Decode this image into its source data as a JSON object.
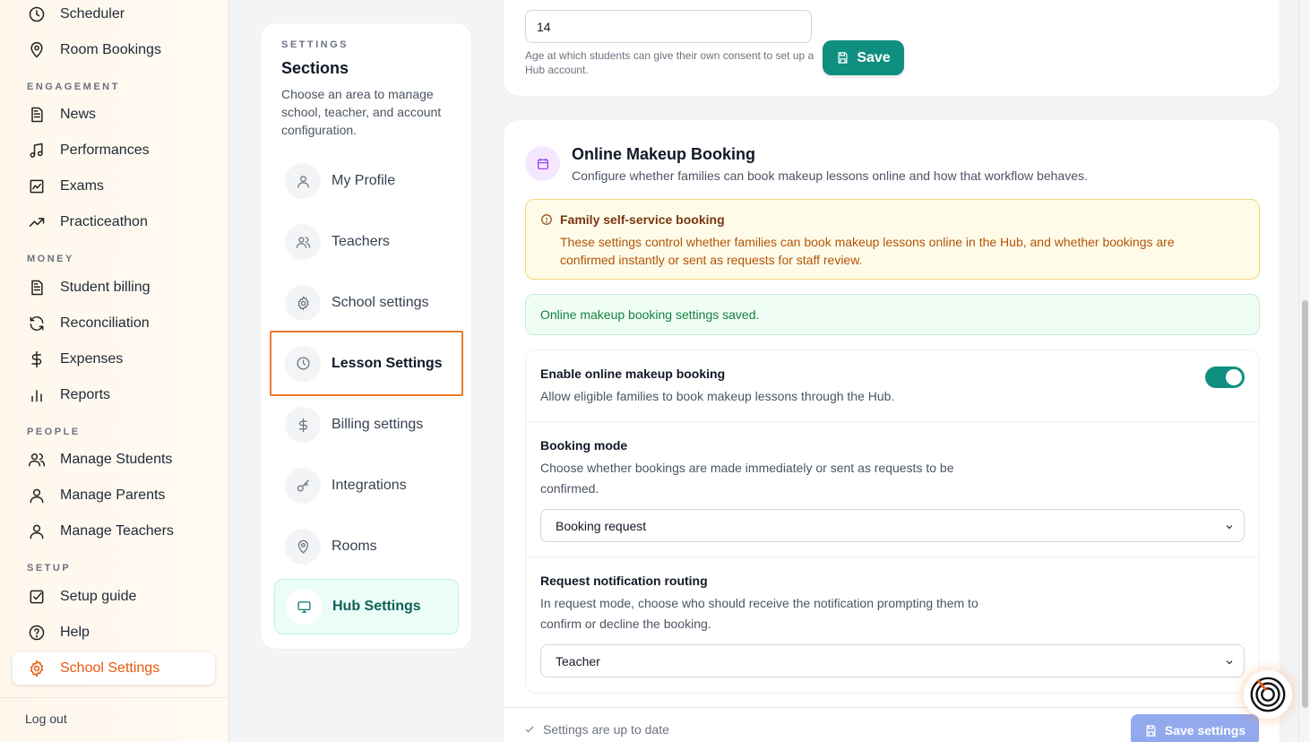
{
  "sidebar": {
    "items_top": [
      {
        "label": "Scheduler",
        "icon": "clock-icon"
      },
      {
        "label": "Room Bookings",
        "icon": "map-pin-icon"
      }
    ],
    "groups": {
      "engagement": "ENGAGEMENT",
      "money": "MONEY",
      "people": "PEOPLE",
      "setup": "SETUP"
    },
    "engagement": [
      {
        "label": "News",
        "icon": "document-icon"
      },
      {
        "label": "Performances",
        "icon": "music-note-icon"
      },
      {
        "label": "Exams",
        "icon": "chart-box-icon"
      },
      {
        "label": "Practiceathon",
        "icon": "trending-up-icon"
      }
    ],
    "money": [
      {
        "label": "Student billing",
        "icon": "document-icon"
      },
      {
        "label": "Reconciliation",
        "icon": "refresh-icon"
      },
      {
        "label": "Expenses",
        "icon": "dollar-icon"
      },
      {
        "label": "Reports",
        "icon": "bar-chart-icon"
      }
    ],
    "people": [
      {
        "label": "Manage Students",
        "icon": "users-icon"
      },
      {
        "label": "Manage Parents",
        "icon": "user-icon"
      },
      {
        "label": "Manage Teachers",
        "icon": "user-icon"
      }
    ],
    "setup": [
      {
        "label": "Setup guide",
        "icon": "checkbox-icon"
      },
      {
        "label": "Help",
        "icon": "help-circle-icon"
      },
      {
        "label": "School Settings",
        "icon": "gear-icon"
      }
    ],
    "logout": "Log out"
  },
  "sections": {
    "kicker": "SETTINGS",
    "title": "Sections",
    "description": "Choose an area to manage school, teacher, and account configuration.",
    "items": [
      {
        "label": "My Profile",
        "icon": "user-icon"
      },
      {
        "label": "Teachers",
        "icon": "users-icon"
      },
      {
        "label": "School settings",
        "icon": "gear-icon"
      },
      {
        "label": "Lesson Settings",
        "icon": "clock-icon"
      },
      {
        "label": "Billing settings",
        "icon": "dollar-icon"
      },
      {
        "label": "Integrations",
        "icon": "key-icon"
      },
      {
        "label": "Rooms",
        "icon": "map-pin-icon"
      },
      {
        "label": "Hub Settings",
        "icon": "monitor-icon"
      }
    ]
  },
  "consent": {
    "age_value": "14",
    "help": "Age at which students can give their own consent to set up a Hub account.",
    "save_label": "Save"
  },
  "makeup": {
    "title": "Online Makeup Booking",
    "description": "Configure whether families can book makeup lessons online and how that workflow behaves.",
    "warning_title": "Family self-service booking",
    "warning_body": "These settings control whether families can book makeup lessons online in the Hub, and whether bookings are confirmed instantly or sent as requests for staff review.",
    "success": "Online makeup booking settings saved.",
    "enable_title": "Enable online makeup booking",
    "enable_desc": "Allow eligible families to book makeup lessons through the Hub.",
    "enable_on": true,
    "mode_title": "Booking mode",
    "mode_desc": "Choose whether bookings are made immediately or sent as requests to be confirmed.",
    "mode_value": "Booking request",
    "routing_title": "Request notification routing",
    "routing_desc": "In request mode, choose who should receive the notification prompting them to confirm or decline the booking.",
    "routing_value": "Teacher"
  },
  "footer": {
    "status": "Settings are up to date",
    "save_settings": "Save settings"
  },
  "colors": {
    "accent_orange": "#ea580c",
    "teal": "#0f8f80",
    "save_disabled": "#93a9ee"
  }
}
